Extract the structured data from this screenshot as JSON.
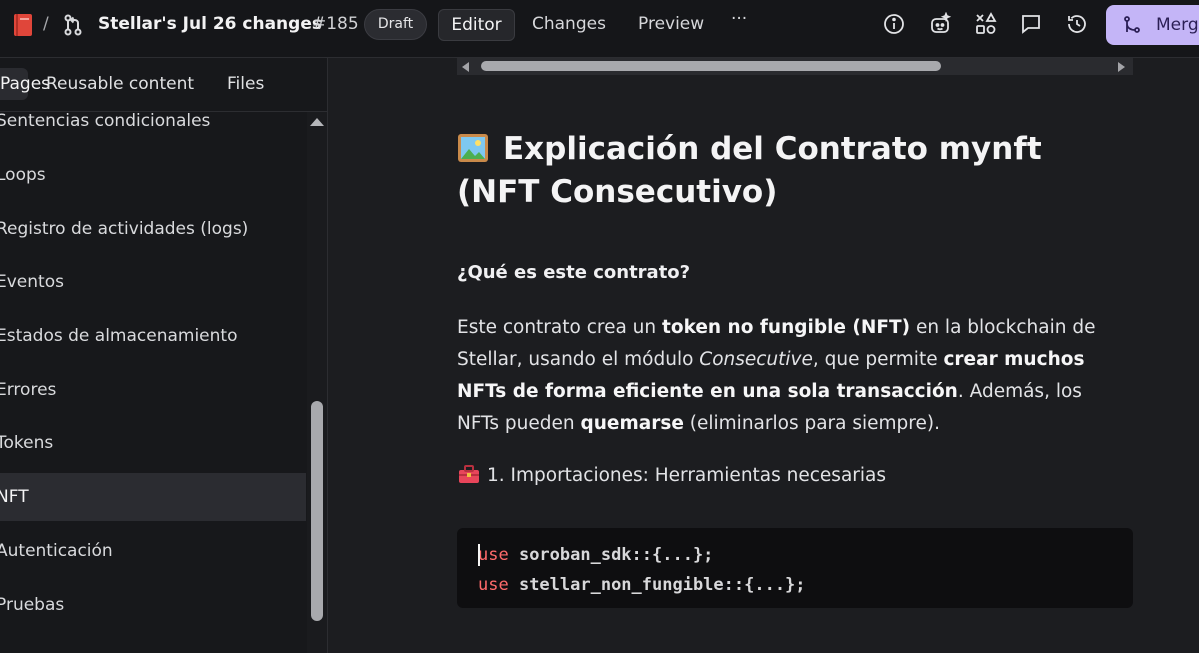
{
  "topbar": {
    "slash": "/",
    "title": "Stellar's Jul 26 changes",
    "number": "#185",
    "badge": "Draft",
    "tabs": [
      "Editor",
      "Changes",
      "Preview"
    ],
    "more": "···",
    "merge_label": "Merge",
    "icons": [
      "book-icon",
      "branch-icon",
      "info-icon",
      "ai-assistant-icon",
      "shapes-icon",
      "comment-icon",
      "history-icon",
      "merge-icon"
    ]
  },
  "sidebar": {
    "tabs": [
      "Pages",
      "Reusable content",
      "Files"
    ],
    "items": [
      "Sentencias condicionales",
      "Loops",
      "Registro de actividades (logs)",
      "Eventos",
      "Estados de almacenamiento",
      "Errores",
      "Tokens",
      "NFT",
      "Autenticación",
      "Pruebas"
    ],
    "active_index": 7
  },
  "document": {
    "heading": "Explicación del Contrato mynft (NFT Consecutivo)",
    "subheading": "¿Qué es este contrato?",
    "paragraph": {
      "p1": "Este contrato crea un ",
      "b1": "token no fungible (NFT)",
      "p2": " en la blockchain de Stellar, usando el módulo ",
      "i1": "Consecutive",
      "p3": ", que permite ",
      "b2": "crear muchos NFTs de forma eficiente en una sola transacción",
      "p4": ". Además, los NFTs pueden ",
      "b3": "quemarse",
      "p5": " (eliminarlos para siempre)."
    },
    "step": "1. Importaciones: Herramientas necesarias",
    "code": [
      {
        "kw": "use",
        "rest": " soroban_sdk::{...};"
      },
      {
        "kw": "use",
        "rest": " stellar_non_fungible::{...};"
      }
    ]
  },
  "colors": {
    "merge_button": "#c4b5f7",
    "keyword": "#ff6b6b",
    "background": "#1c1d20"
  }
}
